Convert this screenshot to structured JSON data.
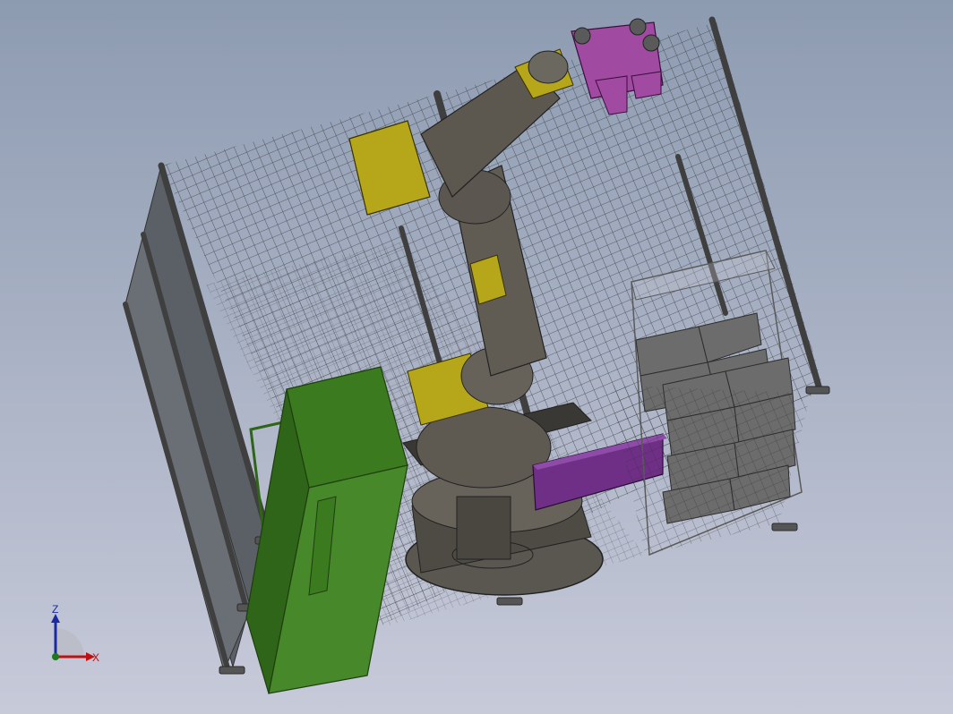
{
  "viewport": {
    "background_top": "#8d9bb1",
    "background_bottom": "#c7cad9"
  },
  "scene": {
    "fence_mesh_color": "#3a3a3a",
    "fence_post_color": "#4a4a4a",
    "robot_body_color": "#5e5a52",
    "robot_accent_color": "#b6a71a",
    "gripper_color": "#a14aa2",
    "part_tray_color": "#6f2f87",
    "green_station_color": "#3b7a1f",
    "green_station_dark": "#2f6518",
    "rack_color": "#6c6c6c"
  },
  "triad": {
    "z_label": "Z",
    "x_label": "X",
    "z_color": "#1c2aa0",
    "x_color": "#c01010"
  }
}
